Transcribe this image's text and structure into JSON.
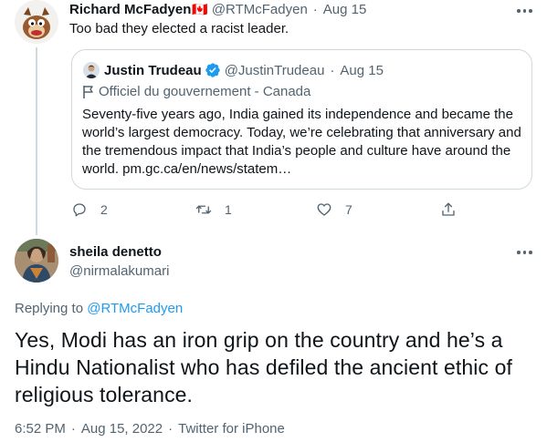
{
  "reply_tweet": {
    "author_name": "Richard McFadyen",
    "flag": "🇨🇦",
    "handle": "@RTMcFadyen",
    "separator": "·",
    "date": "Aug 15",
    "text": "Too bad they elected a racist leader."
  },
  "quoted_tweet": {
    "author_name": "Justin Trudeau",
    "handle": "@JustinTrudeau",
    "separator": "·",
    "date": "Aug 15",
    "label": "Officiel du gouvernement - Canada",
    "text": "Seventy-five years ago, India gained its independence and became the world’s largest democracy. Today, we’re celebrating that anniversary and the tremendous impact that India’s people and culture have around the world. pm.gc.ca/en/news/statem…"
  },
  "actions": {
    "reply_count": "2",
    "retweet_count": "1",
    "like_count": "7"
  },
  "main_tweet": {
    "author_name": "sheila denetto",
    "handle": "@nirmalakumari",
    "replying_prefix": "Replying to",
    "replying_handle": "@RTMcFadyen",
    "text": "Yes, Modi has an iron grip on the country and he’s a Hindu Nationalist who has defiled the ancient ethic of religious tolerance.",
    "time": "6:52 PM",
    "separator": "·",
    "date": "Aug 15, 2022",
    "source": "Twitter for iPhone"
  },
  "colors": {
    "accent": "#1d9bf0",
    "muted": "#536471",
    "text": "#0f1419",
    "border": "#cfd9de"
  }
}
